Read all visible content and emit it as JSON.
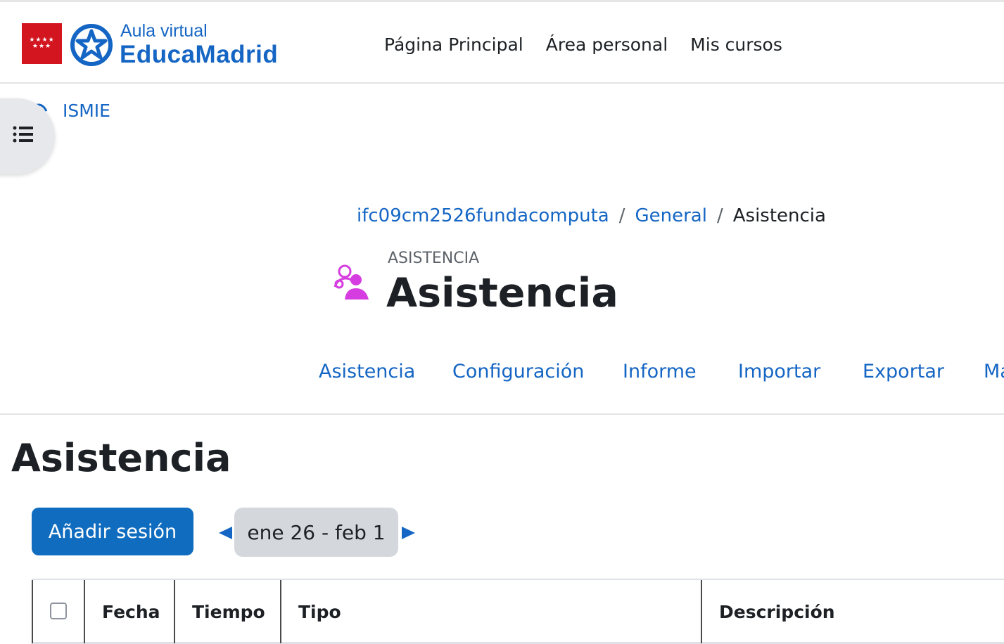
{
  "header": {
    "logo_small": "Aula virtual",
    "logo_big": "EducaMadrid",
    "nav": [
      "Página Principal",
      "Área personal",
      "Mis cursos"
    ]
  },
  "course_index": {
    "label": "ISMIE"
  },
  "breadcrumb": {
    "items": [
      "ifc09cm2526fundacomputa",
      "General"
    ],
    "current": "Asistencia"
  },
  "activity": {
    "pre_title": "ASISTENCIA",
    "title": "Asistencia"
  },
  "tabs": [
    "Asistencia",
    "Configuración",
    "Informe",
    "Importar",
    "Exportar",
    "Ma"
  ],
  "main": {
    "heading": "Asistencia",
    "add_session_label": "Añadir sesión",
    "date_range": "ene 26 - feb 1"
  },
  "table": {
    "columns": [
      "Fecha",
      "Tiempo",
      "Tipo",
      "Descripción"
    ]
  },
  "colors": {
    "accent": "#1566c4",
    "button_primary": "#0f6cbf",
    "activity_icon": "#d63de0",
    "flag_red": "#d2151f"
  }
}
